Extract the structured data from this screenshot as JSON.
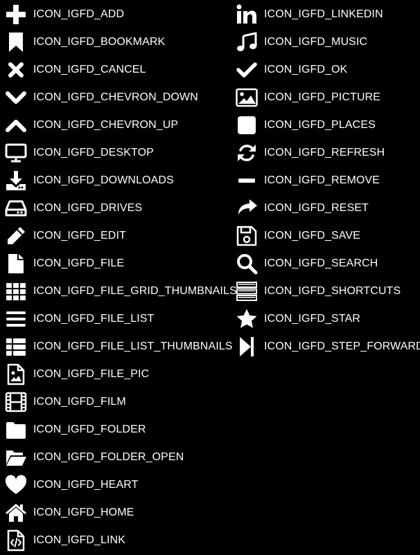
{
  "left_column": [
    {
      "icon": "add-icon",
      "label": "ICON_IGFD_ADD"
    },
    {
      "icon": "bookmark-icon",
      "label": "ICON_IGFD_BOOKMARK"
    },
    {
      "icon": "cancel-icon",
      "label": "ICON_IGFD_CANCEL"
    },
    {
      "icon": "chevron-down-icon",
      "label": "ICON_IGFD_CHEVRON_DOWN"
    },
    {
      "icon": "chevron-up-icon",
      "label": "ICON_IGFD_CHEVRON_UP"
    },
    {
      "icon": "desktop-icon",
      "label": "ICON_IGFD_DESKTOP"
    },
    {
      "icon": "downloads-icon",
      "label": "ICON_IGFD_DOWNLOADS"
    },
    {
      "icon": "drives-icon",
      "label": "ICON_IGFD_DRIVES"
    },
    {
      "icon": "edit-icon",
      "label": "ICON_IGFD_EDIT"
    },
    {
      "icon": "file-icon",
      "label": "ICON_IGFD_FILE"
    },
    {
      "icon": "file-grid-thumbnails-icon",
      "label": "ICON_IGFD_FILE_GRID_THUMBNAILS"
    },
    {
      "icon": "file-list-icon",
      "label": "ICON_IGFD_FILE_LIST"
    },
    {
      "icon": "file-list-thumbnails-icon",
      "label": "ICON_IGFD_FILE_LIST_THUMBNAILS"
    },
    {
      "icon": "file-pic-icon",
      "label": "ICON_IGFD_FILE_PIC"
    },
    {
      "icon": "film-icon",
      "label": "ICON_IGFD_FILM"
    },
    {
      "icon": "folder-icon",
      "label": "ICON_IGFD_FOLDER"
    },
    {
      "icon": "folder-open-icon",
      "label": "ICON_IGFD_FOLDER_OPEN"
    },
    {
      "icon": "heart-icon",
      "label": "ICON_IGFD_HEART"
    },
    {
      "icon": "home-icon",
      "label": "ICON_IGFD_HOME"
    },
    {
      "icon": "link-icon",
      "label": "ICON_IGFD_LINK"
    }
  ],
  "right_column": [
    {
      "icon": "linkedin-icon",
      "label": "ICON_IGFD_LINKEDIN"
    },
    {
      "icon": "music-icon",
      "label": "ICON_IGFD_MUSIC"
    },
    {
      "icon": "ok-icon",
      "label": "ICON_IGFD_OK"
    },
    {
      "icon": "picture-icon",
      "label": "ICON_IGFD_PICTURE"
    },
    {
      "icon": "places-icon",
      "label": "ICON_IGFD_PLACES"
    },
    {
      "icon": "refresh-icon",
      "label": "ICON_IGFD_REFRESH"
    },
    {
      "icon": "remove-icon",
      "label": "ICON_IGFD_REMOVE"
    },
    {
      "icon": "reset-icon",
      "label": "ICON_IGFD_RESET"
    },
    {
      "icon": "save-icon",
      "label": "ICON_IGFD_SAVE"
    },
    {
      "icon": "search-icon",
      "label": "ICON_IGFD_SEARCH"
    },
    {
      "icon": "shortcuts-icon",
      "label": "ICON_IGFD_SHORTCUTS"
    },
    {
      "icon": "star-icon",
      "label": "ICON_IGFD_STAR"
    },
    {
      "icon": "step-forward-icon",
      "label": "ICON_IGFD_STEP_FORWARD"
    }
  ],
  "colors": {
    "background": "#000000",
    "foreground": "#ffffff"
  }
}
